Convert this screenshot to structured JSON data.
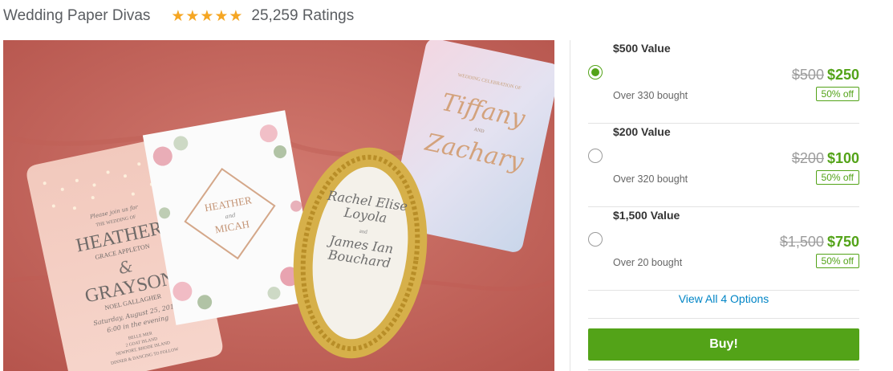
{
  "header": {
    "merchant": "Wedding Paper Divas",
    "rating_stars": 5,
    "ratings_text": "25,259 Ratings"
  },
  "photo": {
    "card1": {
      "line1": "Please join us for",
      "line2": "THE WEDDING OF",
      "name1": "HEATHER",
      "sub1": "GRACE APPLETON",
      "amp": "&",
      "name2": "GRAYSON",
      "sub2": "NOEL GALLAGHER",
      "date": "Saturday, August 25, 2018",
      "time": "6:00 in the evening",
      "venue1": "BELLE MER",
      "venue2": "2 GOAT ISLAND",
      "venue3": "NEWPORT, RHODE ISLAND",
      "dinner": "DINNER & DANCING TO FOLLOW"
    },
    "card2": {
      "name1": "HEATHER",
      "and": "and",
      "name2": "MICAH"
    },
    "card3": {
      "name1": "Rachel Elise",
      "name1b": "Loyola",
      "and": "and",
      "name2": "James Ian",
      "name2b": "Bouchard"
    },
    "card4": {
      "intro": "WEDDING CELEBRATION OF",
      "name1": "Tiffany",
      "and": "AND",
      "name2": "Zachary"
    }
  },
  "options": [
    {
      "title": "$500 Value",
      "original": "$500",
      "price": "$250",
      "bought": "Over 330 bought",
      "discount": "50% off",
      "selected": true
    },
    {
      "title": "$200 Value",
      "original": "$200",
      "price": "$100",
      "bought": "Over 320 bought",
      "discount": "50% off",
      "selected": false
    },
    {
      "title": "$1,500 Value",
      "original": "$1,500",
      "price": "$750",
      "bought": "Over 20 bought",
      "discount": "50% off",
      "selected": false
    }
  ],
  "view_all": "View All 4 Options",
  "buy_label": "Buy!",
  "colors": {
    "accent_green": "#53a318",
    "link_blue": "#0185c6",
    "star_gold": "#f5a623",
    "background_coral": "#c8675e"
  }
}
